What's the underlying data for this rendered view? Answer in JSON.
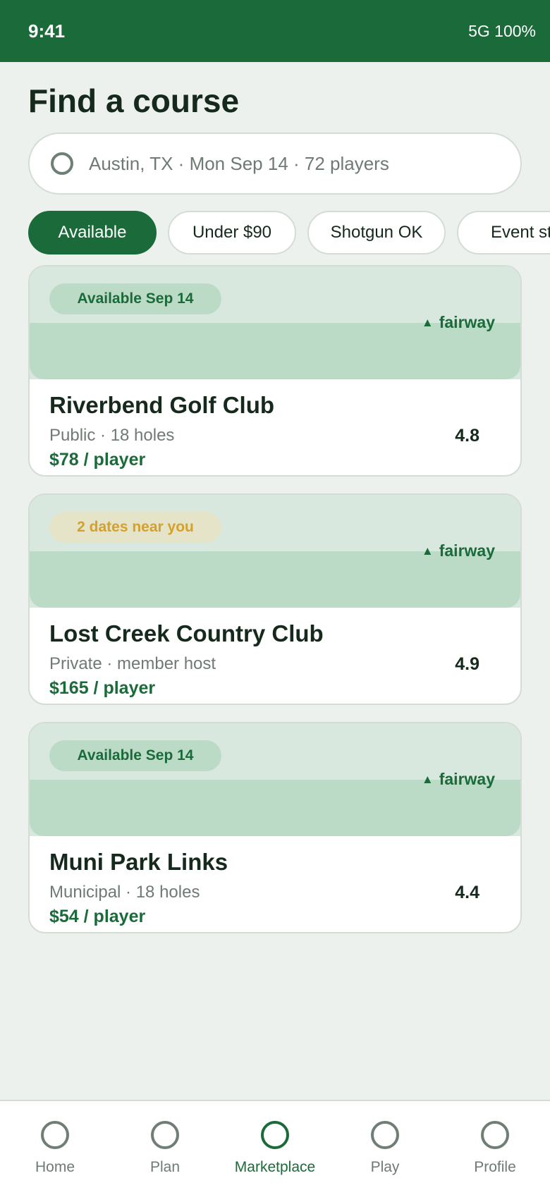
{
  "status_bar": {
    "time": "9:41",
    "signal_battery": "5G 100%"
  },
  "header": {
    "title": "Find a course"
  },
  "search": {
    "icon": "search-icon",
    "text": "Austin, TX · Mon Sep 14 · 72 players"
  },
  "filters": [
    {
      "label": "Available",
      "active": true
    },
    {
      "label": "Under $90",
      "active": false
    },
    {
      "label": "Shotgun OK",
      "active": false
    },
    {
      "label": "Event st",
      "active": false
    }
  ],
  "courses": [
    {
      "badge": "Available Sep 14",
      "badge_tone": "green",
      "tag": "fairway",
      "name": "Riverbend Golf Club",
      "meta": "Public · 18 holes",
      "price": "$78 / player",
      "rating": "4.8"
    },
    {
      "badge": "2 dates near you",
      "badge_tone": "amber",
      "tag": "fairway",
      "name": "Lost Creek Country Club",
      "meta": "Private · member host",
      "price": "$165 / player",
      "rating": "4.9"
    },
    {
      "badge": "Available Sep 14",
      "badge_tone": "green",
      "tag": "fairway",
      "name": "Muni Park Links",
      "meta": "Municipal · 18 holes",
      "price": "$54 / player",
      "rating": "4.4"
    }
  ],
  "tabbar": [
    {
      "label": "Home",
      "active": false
    },
    {
      "label": "Plan",
      "active": false
    },
    {
      "label": "Marketplace",
      "active": true
    },
    {
      "label": "Play",
      "active": false
    },
    {
      "label": "Profile",
      "active": false
    }
  ],
  "colors": {
    "brand": "#1b6b3a",
    "background": "#ecf1ed",
    "hero_light": "#d8e8de",
    "hero_band": "#bbdbc7",
    "amber": "#d4a12a"
  }
}
